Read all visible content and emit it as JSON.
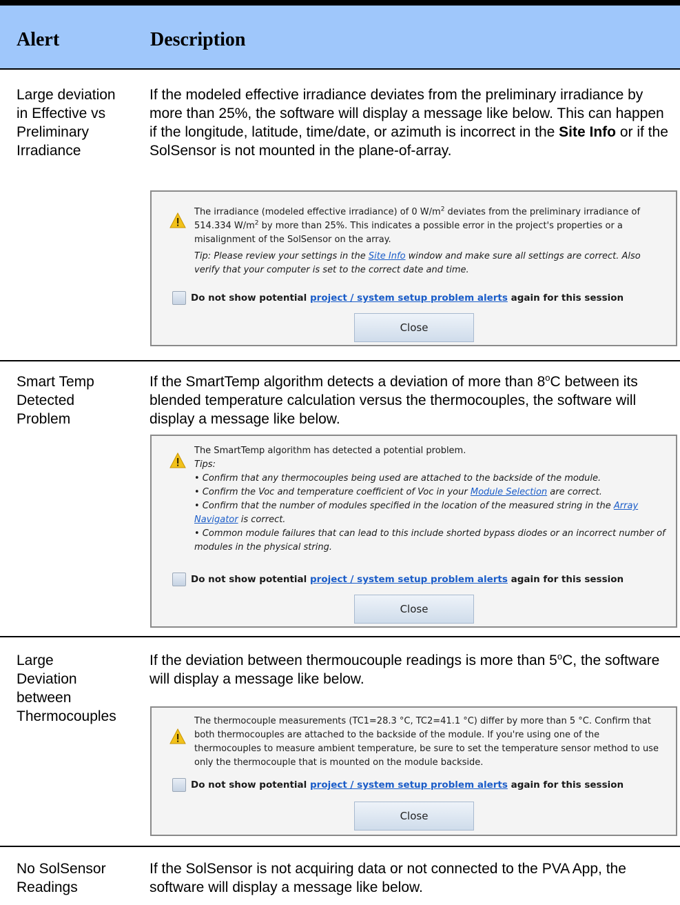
{
  "header": {
    "col_alert": "Alert",
    "col_description": "Description"
  },
  "alerts": [
    {
      "name": [
        "Large deviation",
        "in Effective vs",
        "Preliminary",
        "Irradiance"
      ],
      "description_pre": "If the modeled effective irradiance deviates from the preliminary irradiance by more than 25%, the software will display a message like below.  This can happen if the longitude, latitude, time/date, or azimuth is incorrect in the ",
      "description_bold": "Site Info",
      "description_post": " or if the SolSensor is not mounted in the plane-of-array.",
      "dialog": {
        "message_a": "The irradiance (modeled effective irradiance) of 0 W/m",
        "message_b": " deviates from the preliminary irradiance of 514.334 W/m",
        "message_c": " by more than 25%. This indicates a possible error in the project's properties or a misalignment of the SolSensor on the array.",
        "sup": "2",
        "tip_pre": "Tip: Please review your settings in the ",
        "tip_link": "Site Info",
        "tip_post": " window and make sure all settings are correct. Also verify that your computer is set to the correct date and time.",
        "check_pre": "Do not show potential ",
        "check_link": "project / system setup problem alerts",
        "check_post": " again for this session",
        "close_label": "Close"
      }
    },
    {
      "name": [
        "Smart Temp",
        "Detected",
        "Problem"
      ],
      "description_pre": "If the SmartTemp algorithm detects a deviation of more than 8",
      "description_sup": "o",
      "description_post": "C between its blended temperature calculation versus the thermocouples, the software will display a message like below.",
      "dialog": {
        "message": "The SmartTemp algorithm has detected a potential problem.",
        "tips_label": "Tips:",
        "tip1": "• Confirm that any thermocouples being used are attached to the backside of the module.",
        "tip2_pre": "• Confirm the Voc and temperature coefficient of Voc in your ",
        "tip2_link": "Module Selection",
        "tip2_post": " are correct.",
        "tip3_pre": "• Confirm that the number of modules specified in the location of the measured string in the ",
        "tip3_link": "Array Navigator",
        "tip3_post": " is correct.",
        "tip4": "• Common module failures that can lead to this include shorted bypass diodes or an incorrect number of modules in the physical string.",
        "check_pre": "Do not show potential ",
        "check_link": "project / system setup problem alerts",
        "check_post": " again for this session",
        "close_label": "Close"
      }
    },
    {
      "name": [
        "Large",
        "Deviation",
        "between",
        "Thermocouples"
      ],
      "description_pre": "If the deviation between thermoucouple readings is more than 5",
      "description_sup": "o",
      "description_post": "C, the software will display a message like below.",
      "dialog": {
        "message": "The thermocouple measurements (TC1=28.3 °C, TC2=41.1 °C) differ by more than 5 °C. Confirm that both thermocouples are attached to the backside of the module. If you're using one of the thermocouples to measure ambient temperature, be sure to set the temperature sensor method to use only the thermocouple that is mounted on the module backside.",
        "check_pre": "Do not show potential ",
        "check_link": "project / system setup problem alerts",
        "check_post": " again for this session",
        "close_label": "Close"
      }
    },
    {
      "name": [
        "No SolSensor",
        "Readings"
      ],
      "description": "If the SolSensor is not acquiring data or not connected to the PVA App, the software will display a message like below."
    }
  ],
  "colors": {
    "header_bg": "#9fc7fb",
    "link": "#1a5cc8",
    "warning": "#f2c21b"
  }
}
